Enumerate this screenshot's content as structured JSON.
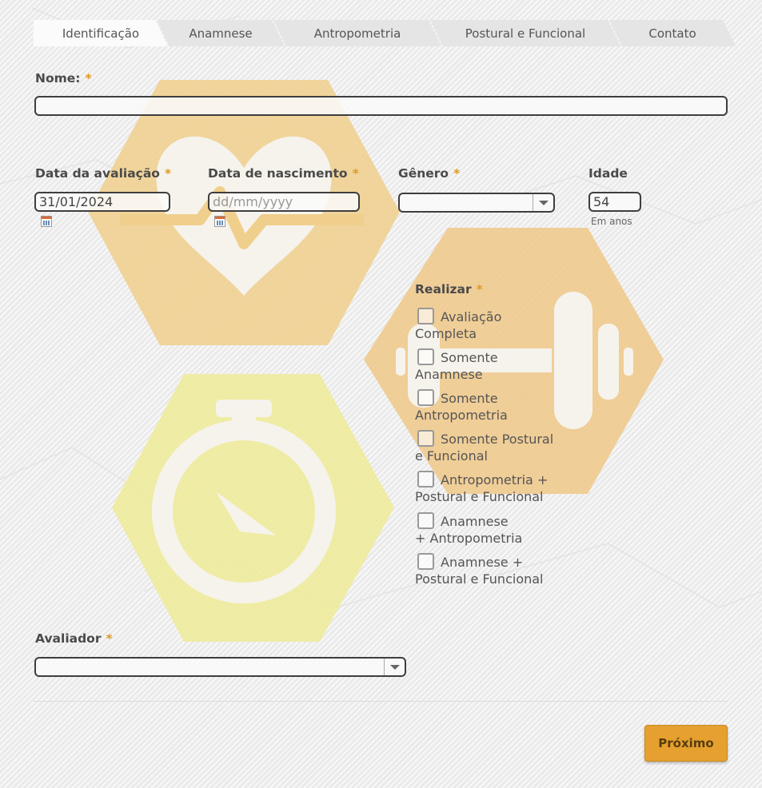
{
  "tabs": [
    "Identificação",
    "Anamnese",
    "Antropometria",
    "Postural e Funcional",
    "Contato"
  ],
  "active_tab": "Identificação",
  "form": {
    "name": {
      "label": "Nome:",
      "required": "*",
      "value": ""
    },
    "eval_date": {
      "label": "Data da avaliação",
      "required": "*",
      "value": "31/01/2024",
      "icon": "calendar-icon"
    },
    "birth_date": {
      "label": "Data de nascimento",
      "required": "*",
      "placeholder": "dd/mm/yyyy",
      "icon": "calendar-icon"
    },
    "gender": {
      "label": "Gênero",
      "required": "*",
      "value": "",
      "icon": "chevron-down-icon"
    },
    "age": {
      "label": "Idade",
      "value": "54",
      "hint": "Em anos"
    },
    "realizar": {
      "label": "Realizar",
      "required": "*",
      "options": [
        {
          "line1": "Avaliação",
          "line2": "Completa",
          "checked": false
        },
        {
          "line1": "Somente",
          "line2": "Anamnese",
          "checked": false
        },
        {
          "line1": "Somente",
          "line2": "Antropometria",
          "checked": false
        },
        {
          "line1": "Somente Postural",
          "line2": "e Funcional",
          "checked": false
        },
        {
          "line1": "Antropometria +",
          "line2": "Postural e Funcional",
          "checked": false
        },
        {
          "line1": "Anamnese",
          "line2": "+ Antropometria",
          "checked": false
        },
        {
          "line1": "Anamnese +",
          "line2": "Postural e Funcional",
          "checked": false
        }
      ]
    },
    "evaluator": {
      "label": "Avaliador",
      "required": "*",
      "value": "",
      "icon": "chevron-down-icon"
    }
  },
  "next_button": "Próximo",
  "colors": {
    "accent": "#e5a02f",
    "required": "#e09a26",
    "heart_hex": "#f0cf8c",
    "dumbbell_hex": "#f0c888",
    "timer_hex": "#eeeb98"
  },
  "background_icons": [
    "heart-pulse-icon",
    "dumbbell-icon",
    "stopwatch-icon"
  ]
}
